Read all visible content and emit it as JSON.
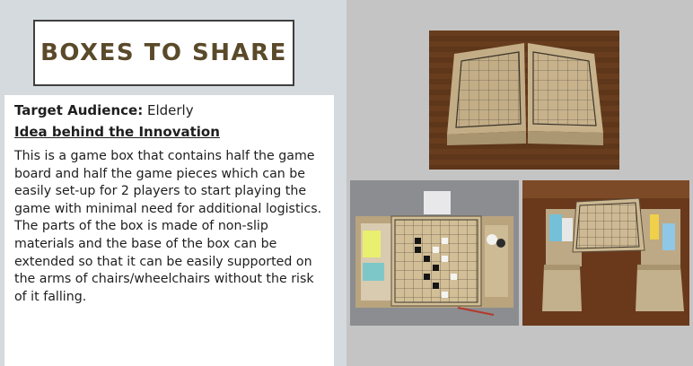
{
  "title": "BOXES TO SHARE",
  "audience": {
    "label": "Target Audience:",
    "value": "Elderly"
  },
  "idea": {
    "heading": "Idea behind the Innovation",
    "body": "This is a game box that contains half the game board and half the game pieces which can be easily set-up for 2 players to start playing the game with minimal need for additional logistics. The parts of the box is made of  non-slip materials and the base of the box can be extended so that it can be easily supported on the arms of chairs/wheelchairs without the risk of it falling."
  },
  "colors": {
    "left_panel_bg": "#d4dadd",
    "title_text": "#5a4a2a",
    "right_panel_bg": "#c4c4c4",
    "wood": "#6b3a1c",
    "cardboard": "#c9b48f"
  },
  "photos": [
    {
      "name": "closed-game-boxes-photo"
    },
    {
      "name": "open-box-with-pieces-photo"
    },
    {
      "name": "box-on-extended-supports-photo"
    }
  ]
}
